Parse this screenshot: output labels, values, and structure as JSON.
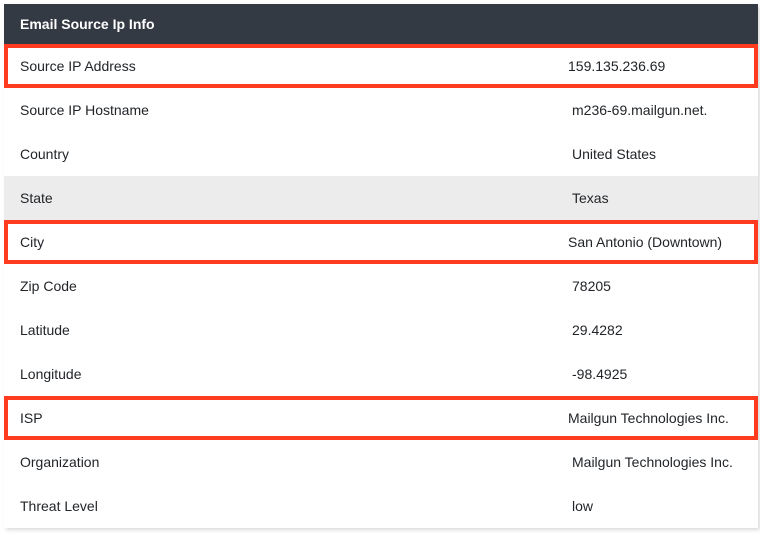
{
  "header": {
    "title": "Email Source Ip Info"
  },
  "rows": [
    {
      "label": "Source IP Address",
      "value": "159.135.236.69",
      "highlighted": true,
      "shaded": false
    },
    {
      "label": "Source IP Hostname",
      "value": "m236-69.mailgun.net.",
      "highlighted": false,
      "shaded": false
    },
    {
      "label": "Country",
      "value": "United States",
      "highlighted": false,
      "shaded": false
    },
    {
      "label": "State",
      "value": "Texas",
      "highlighted": false,
      "shaded": true
    },
    {
      "label": "City",
      "value": "San Antonio (Downtown)",
      "highlighted": true,
      "shaded": false
    },
    {
      "label": "Zip Code",
      "value": "78205",
      "highlighted": false,
      "shaded": false
    },
    {
      "label": "Latitude",
      "value": "29.4282",
      "highlighted": false,
      "shaded": false
    },
    {
      "label": "Longitude",
      "value": "-98.4925",
      "highlighted": false,
      "shaded": false
    },
    {
      "label": "ISP",
      "value": "Mailgun Technologies Inc.",
      "highlighted": true,
      "shaded": false
    },
    {
      "label": "Organization",
      "value": "Mailgun Technologies Inc.",
      "highlighted": false,
      "shaded": false
    },
    {
      "label": "Threat Level",
      "value": "low",
      "highlighted": false,
      "shaded": false
    }
  ]
}
